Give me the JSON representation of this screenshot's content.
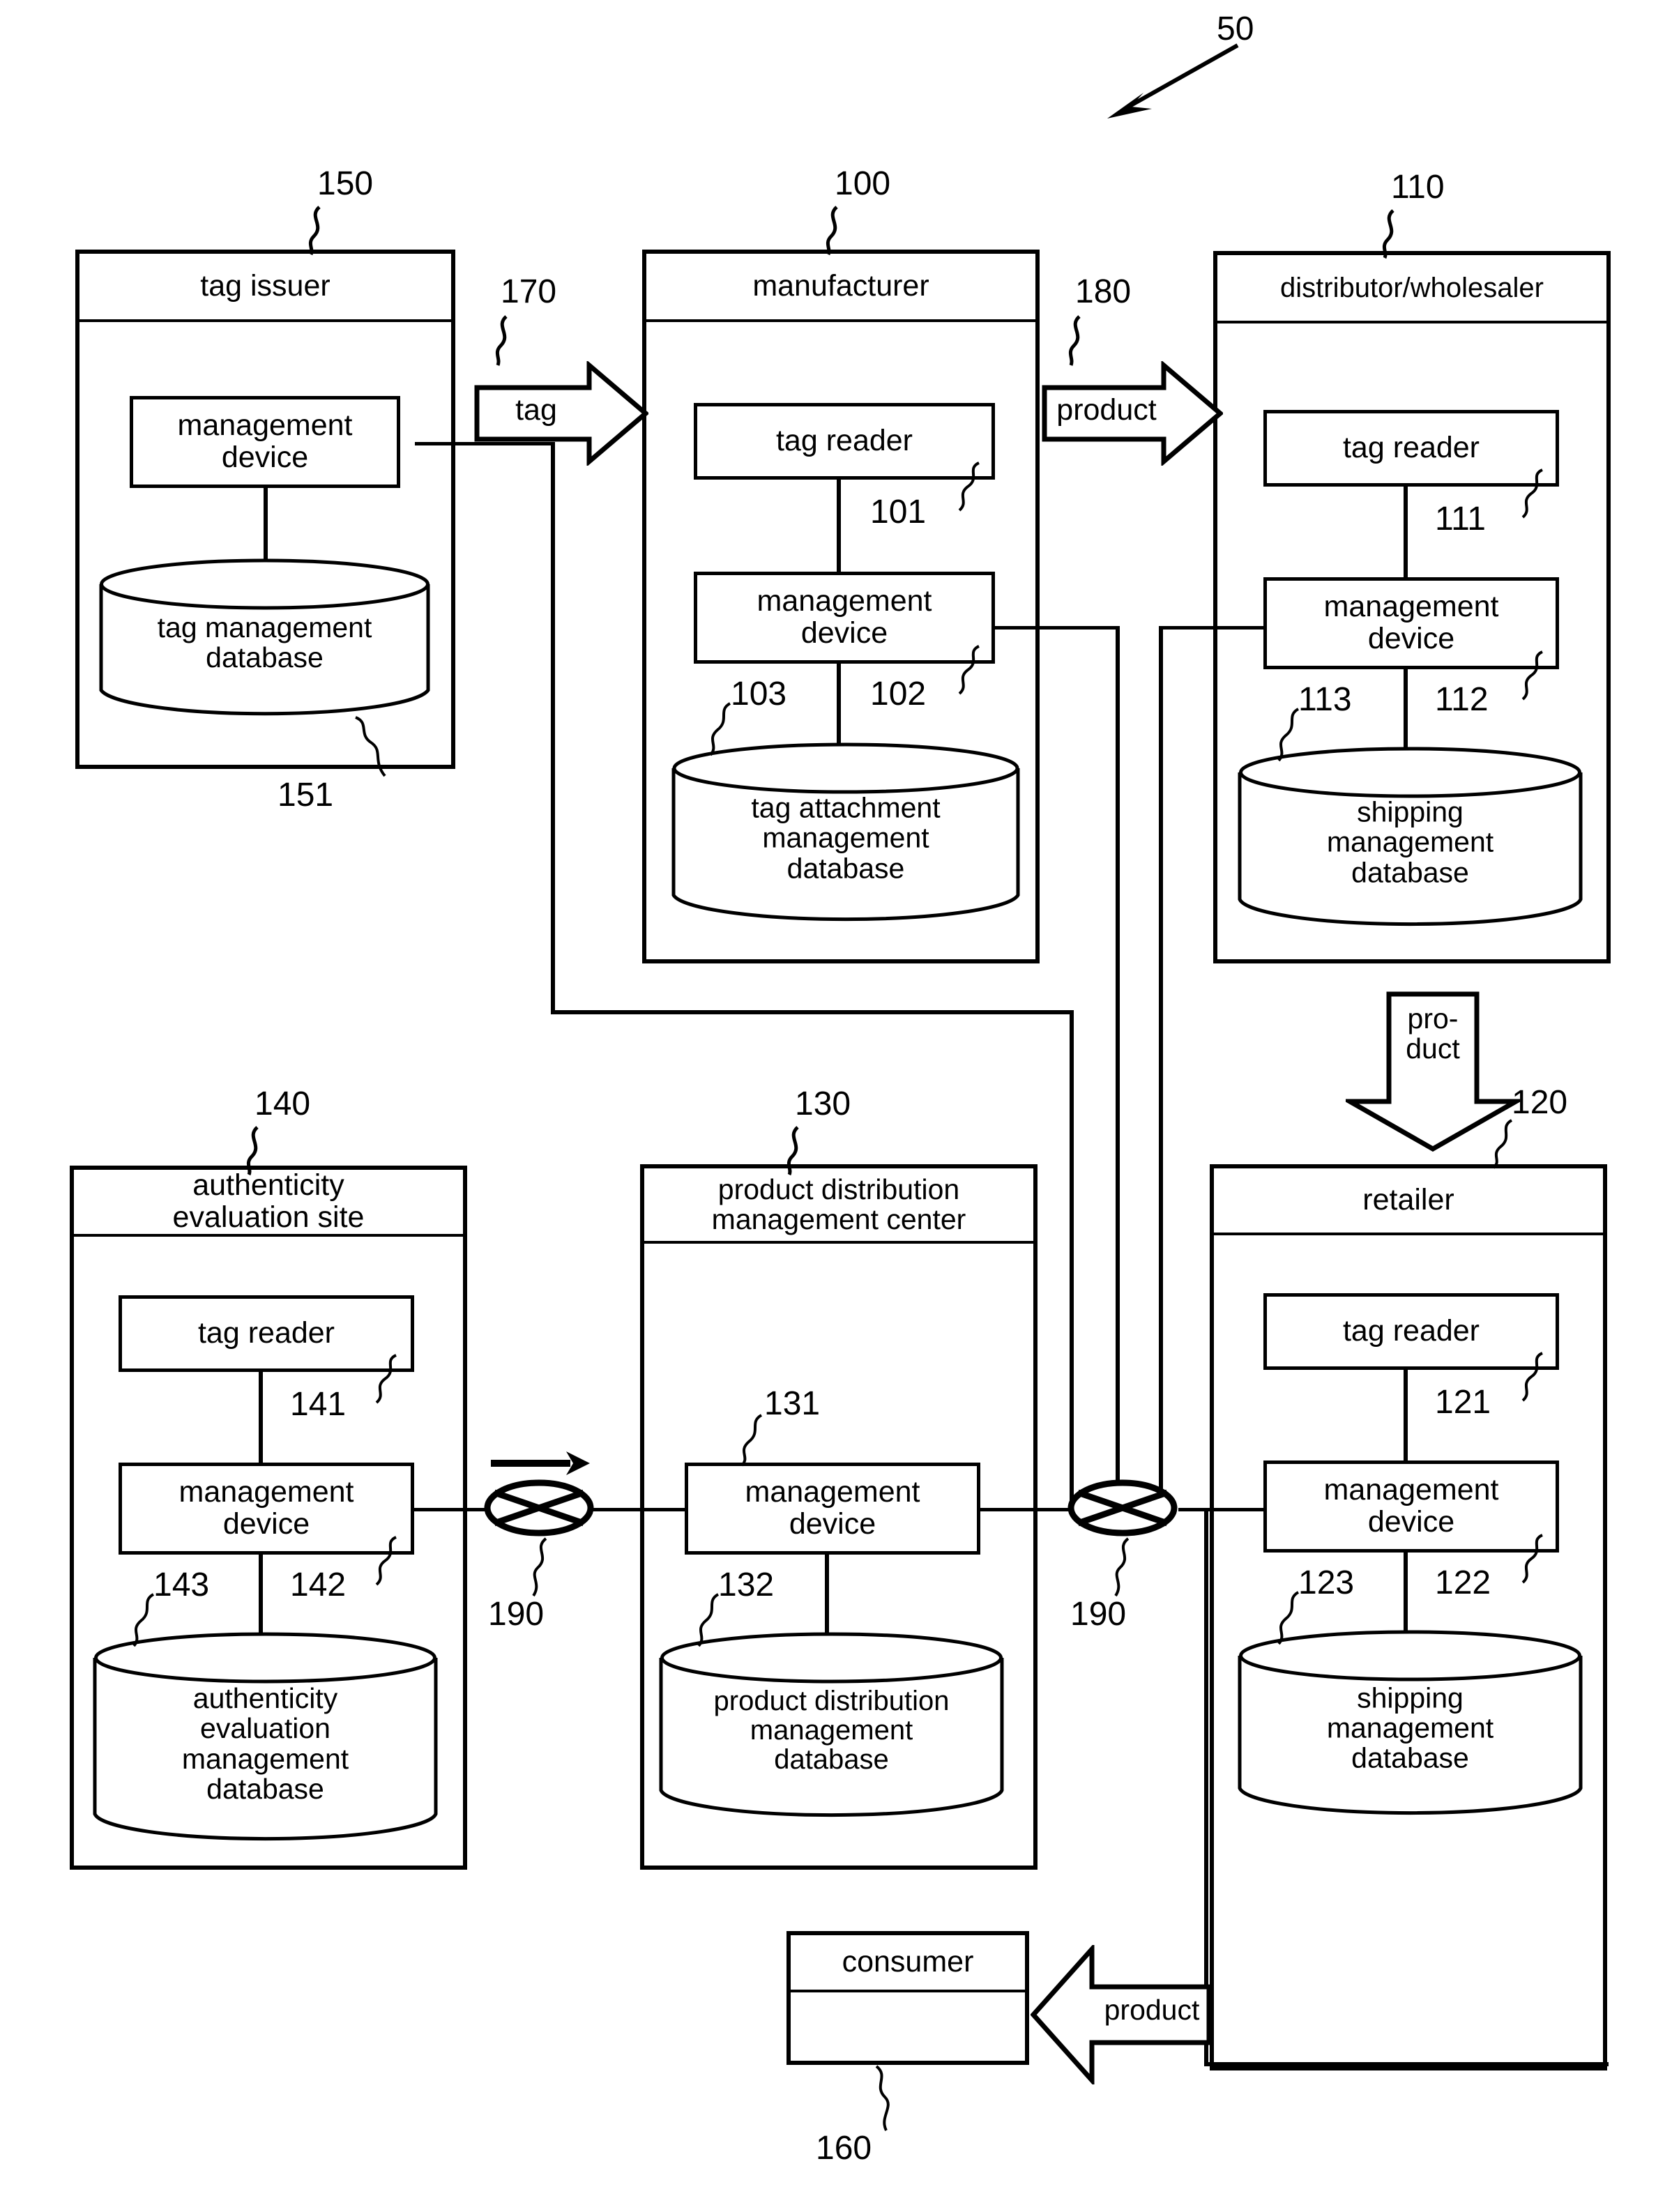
{
  "figure": {
    "system_ref": "50"
  },
  "entities": {
    "tag_issuer": {
      "title": "tag issuer",
      "ref": "150",
      "management_device": "management\ndevice",
      "database": "tag management\ndatabase",
      "database_ref": "151"
    },
    "manufacturer": {
      "title": "manufacturer",
      "ref": "100",
      "tag_reader": "tag reader",
      "tag_reader_ref": "101",
      "management_device": "management\ndevice",
      "management_device_ref": "102",
      "database": "tag attachment\nmanagement\ndatabase",
      "database_ref": "103"
    },
    "distributor": {
      "title": "distributor/wholesaler",
      "ref": "110",
      "tag_reader": "tag reader",
      "tag_reader_ref": "111",
      "management_device": "management\ndevice",
      "management_device_ref": "112",
      "database": "shipping\nmanagement\ndatabase",
      "database_ref": "113"
    },
    "authenticity_site": {
      "title": "authenticity\nevaluation site",
      "ref": "140",
      "tag_reader": "tag reader",
      "tag_reader_ref": "141",
      "management_device": "management\ndevice",
      "management_device_ref": "142",
      "database": "authenticity\nevaluation\nmanagement\ndatabase",
      "database_ref": "143"
    },
    "distribution_center": {
      "title": "product distribution\nmanagement center",
      "ref": "130",
      "management_device": "management\ndevice",
      "management_device_ref": "131",
      "database": "product distribution\nmanagement\ndatabase",
      "database_ref": "132"
    },
    "retailer": {
      "title": "retailer",
      "ref": "120",
      "tag_reader": "tag reader",
      "tag_reader_ref": "121",
      "management_device": "management\ndevice",
      "management_device_ref": "122",
      "database": "shipping\nmanagement\ndatabase",
      "database_ref": "123"
    },
    "consumer": {
      "title": "consumer",
      "ref": "160"
    }
  },
  "flow_arrows": {
    "tag": {
      "label": "tag",
      "ref": "170"
    },
    "product_to_distributor": {
      "label": "product",
      "ref": "180"
    },
    "product_to_retailer": {
      "label": "pro-\nduct"
    },
    "product_to_consumer": {
      "label": "product"
    }
  },
  "network_nodes": {
    "left": {
      "ref": "190"
    },
    "right": {
      "ref": "190"
    }
  }
}
